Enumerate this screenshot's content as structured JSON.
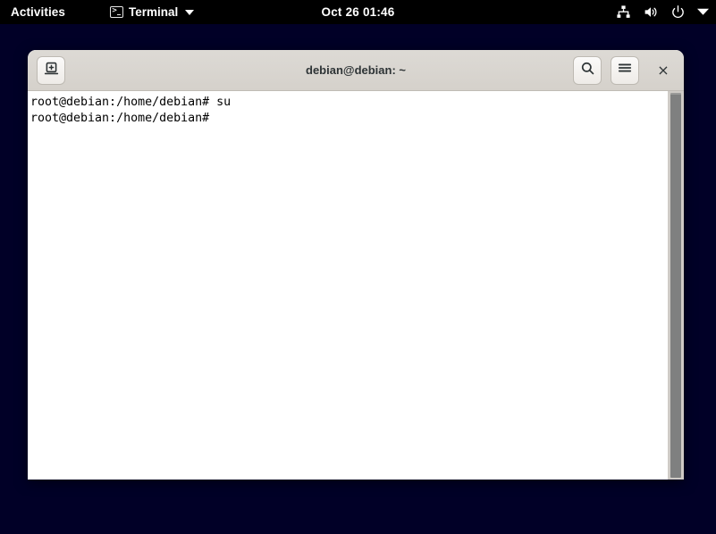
{
  "topbar": {
    "activities_label": "Activities",
    "app_name": "Terminal",
    "app_icon": "terminal-icon",
    "app_menu_caret": "chevron-down-icon",
    "clock": "Oct 26  01:46",
    "status_icons": [
      "network-wired-icon",
      "volume-icon",
      "power-icon",
      "chevron-down-icon"
    ]
  },
  "window": {
    "title": "debian@debian: ~",
    "new_tab_icon": "new-tab-icon",
    "search_icon": "search-icon",
    "menu_icon": "hamburger-menu-icon",
    "close_label": "×"
  },
  "terminal": {
    "lines": [
      "root@debian:/home/debian# su",
      "root@debian:/home/debian#"
    ],
    "content": "root@debian:/home/debian# su\nroot@debian:/home/debian#",
    "background": "#ffffff",
    "foreground": "#000000"
  },
  "desktop": {
    "background": "#010027"
  }
}
